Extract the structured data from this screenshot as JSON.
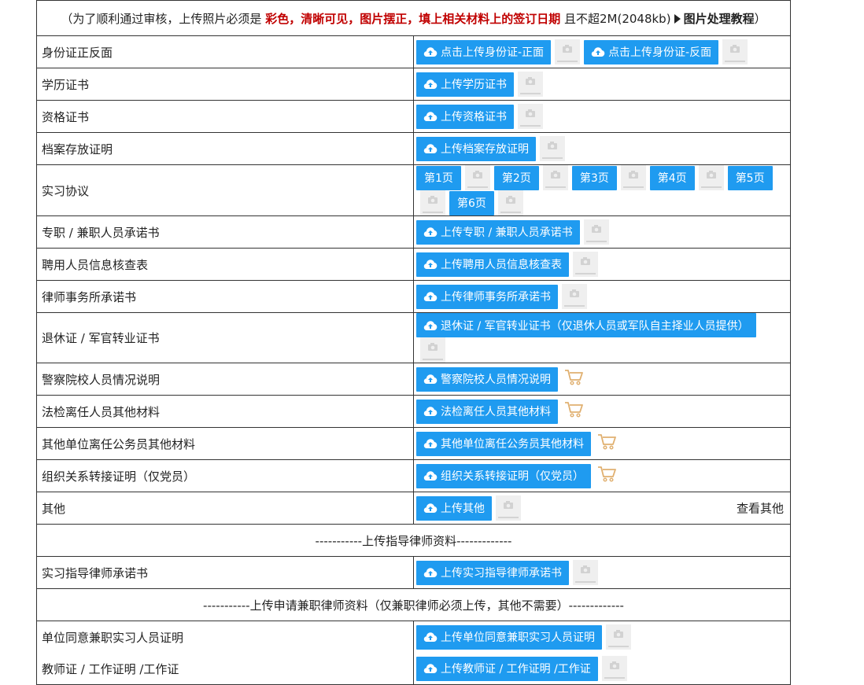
{
  "notice": {
    "prefix": "（为了顺利通过审核，上传照片必须是",
    "highlight": "彩色，清晰可见，图片摆正，填上相关材料上的签订日期",
    "suffix": "且不超2M(2048kb)",
    "tutorial": "图片处理教程",
    "close": "）"
  },
  "rows": [
    {
      "label": "身份证正反面",
      "buttons": [
        "点击上传身份证-正面",
        "点击上传身份证-反面"
      ]
    },
    {
      "label": "学历证书",
      "buttons": [
        "上传学历证书"
      ]
    },
    {
      "label": "资格证书",
      "buttons": [
        "上传资格证书"
      ]
    },
    {
      "label": "档案存放证明",
      "buttons": [
        "上传档案存放证明"
      ]
    },
    {
      "label": "实习协议",
      "pages": [
        "第1页",
        "第2页",
        "第3页",
        "第4页",
        "第5页",
        "第6页"
      ]
    },
    {
      "label": "专职 / 兼职人员承诺书",
      "buttons": [
        "上传专职 / 兼职人员承诺书"
      ]
    },
    {
      "label": "聘用人员信息核查表",
      "buttons": [
        "上传聘用人员信息核查表"
      ]
    },
    {
      "label": "律师事务所承诺书",
      "buttons": [
        "上传律师事务所承诺书"
      ]
    },
    {
      "label": "退休证 / 军官转业证书",
      "buttons": [
        "退休证 / 军官转业证书（仅退休人员或军队自主择业人员提供）"
      ]
    },
    {
      "label": "警察院校人员情况说明",
      "buttons": [
        "警察院校人员情况说明"
      ]
    },
    {
      "label": "法检离任人员其他材料",
      "buttons": [
        "法检离任人员其他材料"
      ]
    },
    {
      "label": "其他单位离任公务员其他材料",
      "buttons": [
        "其他单位离任公务员其他材料"
      ]
    },
    {
      "label": "组织关系转接证明（仅党员）",
      "buttons": [
        "组织关系转接证明（仅党员）"
      ]
    },
    {
      "label": "其他",
      "buttons": [
        "上传其他"
      ],
      "link": "查看其他"
    }
  ],
  "section_mentor": "-----------上传指导律师资料-------------",
  "mentor_row": {
    "label": "实习指导律师承诺书",
    "button": "上传实习指导律师承诺书"
  },
  "section_parttime": "-----------上传申请兼职律师资料（仅兼职律师必须上传，其他不需要）-------------",
  "parttime_rows": [
    {
      "label": "单位同意兼职实习人员证明",
      "button": "上传单位同意兼职实习人员证明"
    },
    {
      "label": "教师证 / 工作证明 /工作证",
      "button": "上传教师证 / 工作证明 /工作证"
    }
  ],
  "colors": {
    "button": "#1f9bf0",
    "highlight": "#c00000",
    "cart": "#e0b070"
  },
  "icons": {
    "upload": "cloud-upload-icon",
    "thumb": "image-placeholder-icon",
    "cart": "shopping-cart-icon",
    "tutorial": "play-triangle-icon"
  }
}
